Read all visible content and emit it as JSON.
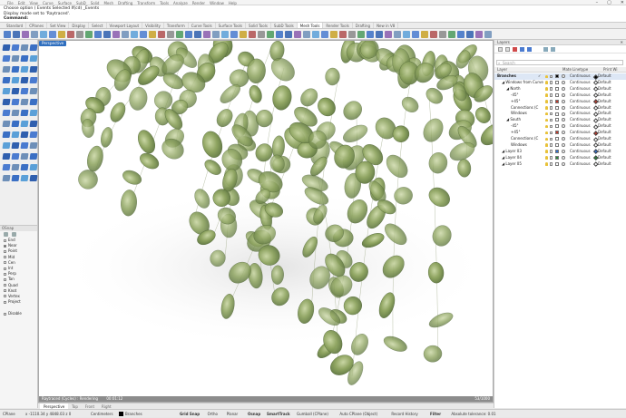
{
  "menu": [
    "File",
    "Edit",
    "View",
    "Curve",
    "Surface",
    "SubD",
    "Solid",
    "Mesh",
    "Drafting",
    "Transform",
    "Tools",
    "Analyze",
    "Render",
    "Window",
    "Help"
  ],
  "command": {
    "line1": "Choose option ( Events  Selected  If(cd)  _Events",
    "line2": "Display mode set to 'Raytraced'.",
    "prompt": "Command:"
  },
  "tabs": [
    "Standard",
    "CPlanes",
    "Set View",
    "Display",
    "Select",
    "Viewport Layout",
    "Visibility",
    "Transform",
    "Curve Tools",
    "Surface Tools",
    "Solid Tools",
    "SubD Tools",
    "Mesh Tools",
    "Render Tools",
    "Drafting",
    "New in V8"
  ],
  "active_tab": "Mesh Tools",
  "viewport": {
    "label": "Perspective",
    "progress_text": "Raytraced (Cycles)  :  Rendering",
    "progress_time": "00:01:12",
    "progress_right": "53/1000"
  },
  "viewtabs": [
    "Perspective",
    "Top",
    "Front",
    "Right"
  ],
  "osnap": {
    "title": "OSnap",
    "items": [
      {
        "label": "End",
        "on": false
      },
      {
        "label": "Near",
        "on": true
      },
      {
        "label": "Point",
        "on": false
      },
      {
        "label": "Mid",
        "on": false
      },
      {
        "label": "Cen",
        "on": false
      },
      {
        "label": "Int",
        "on": false
      },
      {
        "label": "Perp",
        "on": false
      },
      {
        "label": "Tan",
        "on": false
      },
      {
        "label": "Quad",
        "on": false
      },
      {
        "label": "Knot",
        "on": false
      },
      {
        "label": "Vertex",
        "on": false
      },
      {
        "label": "Project",
        "on": false
      }
    ],
    "disable": "Disable"
  },
  "layers": {
    "title": "Layers",
    "search_placeholder": "Search",
    "columns": {
      "layer": "Layer",
      "mat": "Mate",
      "linetype": "Linetype",
      "printwidth": "Print Wi"
    },
    "rows": [
      {
        "name": "Branches",
        "indent": 0,
        "color": "#000000",
        "lt": "Continuous",
        "pw": "Default",
        "current": true,
        "bold": true
      },
      {
        "name": "Windows from Curve",
        "indent": 1,
        "color": "#ffffff",
        "lt": "Continuous",
        "pw": "Default"
      },
      {
        "name": "North",
        "indent": 2,
        "color": "#ffffff",
        "lt": "Continuous",
        "pw": "Default"
      },
      {
        "name": "-45°",
        "indent": 3,
        "color": "#ffffff",
        "lt": "Continuous",
        "pw": "Default"
      },
      {
        "name": "+45°",
        "indent": 3,
        "color": "#c0392b",
        "lt": "Continuous",
        "pw": "Default"
      },
      {
        "name": "Connections (C",
        "indent": 3,
        "color": "#ffffff",
        "lt": "Continuous",
        "pw": "Default"
      },
      {
        "name": "Windows",
        "indent": 3,
        "color": "#ffffff",
        "lt": "Continuous",
        "pw": "Default"
      },
      {
        "name": "South",
        "indent": 2,
        "color": "#ffffff",
        "lt": "Continuous",
        "pw": "Default"
      },
      {
        "name": "-45°",
        "indent": 3,
        "color": "#ffffff",
        "lt": "Continuous",
        "pw": "Default"
      },
      {
        "name": "+45°",
        "indent": 3,
        "color": "#c0392b",
        "lt": "Continuous",
        "pw": "Default"
      },
      {
        "name": "Connections (C",
        "indent": 3,
        "color": "#ffffff",
        "lt": "Continuous",
        "pw": "Default"
      },
      {
        "name": "Windows",
        "indent": 3,
        "color": "#ffffff",
        "lt": "Continuous",
        "pw": "Default"
      },
      {
        "name": "Layer 03",
        "indent": 1,
        "color": "#2e6fd1",
        "lt": "Continuous",
        "pw": "Default"
      },
      {
        "name": "Layer 04",
        "indent": 1,
        "color": "#2b8a3e",
        "lt": "Continuous",
        "pw": "Default"
      },
      {
        "name": "Layer 05",
        "indent": 1,
        "color": "#ffffff",
        "lt": "Continuous",
        "pw": "Default"
      }
    ]
  },
  "status": {
    "cplane": "CPlane",
    "coords": "x -1110.34  y 4848.03  z 0",
    "units": "Centimeters",
    "layer": "Branches",
    "toggles": [
      "Grid Snap",
      "Ortho",
      "Planar",
      "Osnap",
      "SmartTrack",
      "Gumball (CPlane)",
      "Auto CPlane (Object)",
      "Record History",
      "Filter",
      "Absolute tolerance: 0.01"
    ]
  }
}
